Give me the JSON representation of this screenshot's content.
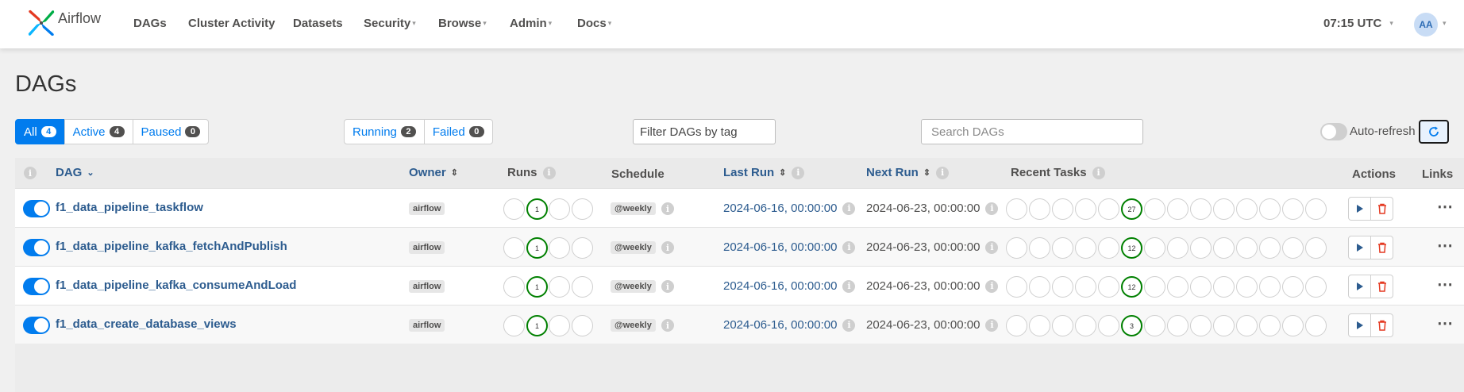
{
  "nav": {
    "brand": "Airflow",
    "items": [
      "DAGs",
      "Cluster Activity",
      "Datasets",
      "Security",
      "Browse",
      "Admin",
      "Docs"
    ],
    "time": "07:15 UTC",
    "avatar": "AA"
  },
  "page_title": "DAGs",
  "status_filters": [
    {
      "label": "All",
      "count": "4"
    },
    {
      "label": "Active",
      "count": "4"
    },
    {
      "label": "Paused",
      "count": "0"
    }
  ],
  "run_filters": [
    {
      "label": "Running",
      "count": "2"
    },
    {
      "label": "Failed",
      "count": "0"
    }
  ],
  "tag_filter": {
    "placeholder": "Filter DAGs by tag"
  },
  "search": {
    "placeholder": "Search DAGs"
  },
  "auto_refresh": {
    "label": "Auto-refresh",
    "enabled": false
  },
  "table": {
    "headers": {
      "dag": "DAG",
      "owner": "Owner",
      "runs": "Runs",
      "schedule": "Schedule",
      "last_run": "Last Run",
      "next_run": "Next Run",
      "recent_tasks": "Recent Tasks",
      "actions": "Actions",
      "links": "Links"
    },
    "rows": [
      {
        "name": "f1_data_pipeline_taskflow",
        "owner": "airflow",
        "runs_success": "1",
        "schedule": "@weekly",
        "last_run": "2024-06-16, 00:00:00",
        "next_run": "2024-06-23, 00:00:00",
        "recent_success": "27"
      },
      {
        "name": "f1_data_pipeline_kafka_fetchAndPublish",
        "owner": "airflow",
        "runs_success": "1",
        "schedule": "@weekly",
        "last_run": "2024-06-16, 00:00:00",
        "next_run": "2024-06-23, 00:00:00",
        "recent_success": "12"
      },
      {
        "name": "f1_data_pipeline_kafka_consumeAndLoad",
        "owner": "airflow",
        "runs_success": "1",
        "schedule": "@weekly",
        "last_run": "2024-06-16, 00:00:00",
        "next_run": "2024-06-23, 00:00:00",
        "recent_success": "12"
      },
      {
        "name": "f1_data_create_database_views",
        "owner": "airflow",
        "runs_success": "1",
        "schedule": "@weekly",
        "last_run": "2024-06-16, 00:00:00",
        "next_run": "2024-06-23, 00:00:00",
        "recent_success": "3"
      }
    ]
  },
  "colors": {
    "accent": "#017cee",
    "success": "#008000",
    "danger": "#e43921",
    "link": "#2d5c8f"
  },
  "icons": {
    "play": "play-icon",
    "delete": "trash-icon",
    "more": "more-horizontal-icon",
    "refresh": "refresh-icon",
    "info": "info-icon"
  }
}
